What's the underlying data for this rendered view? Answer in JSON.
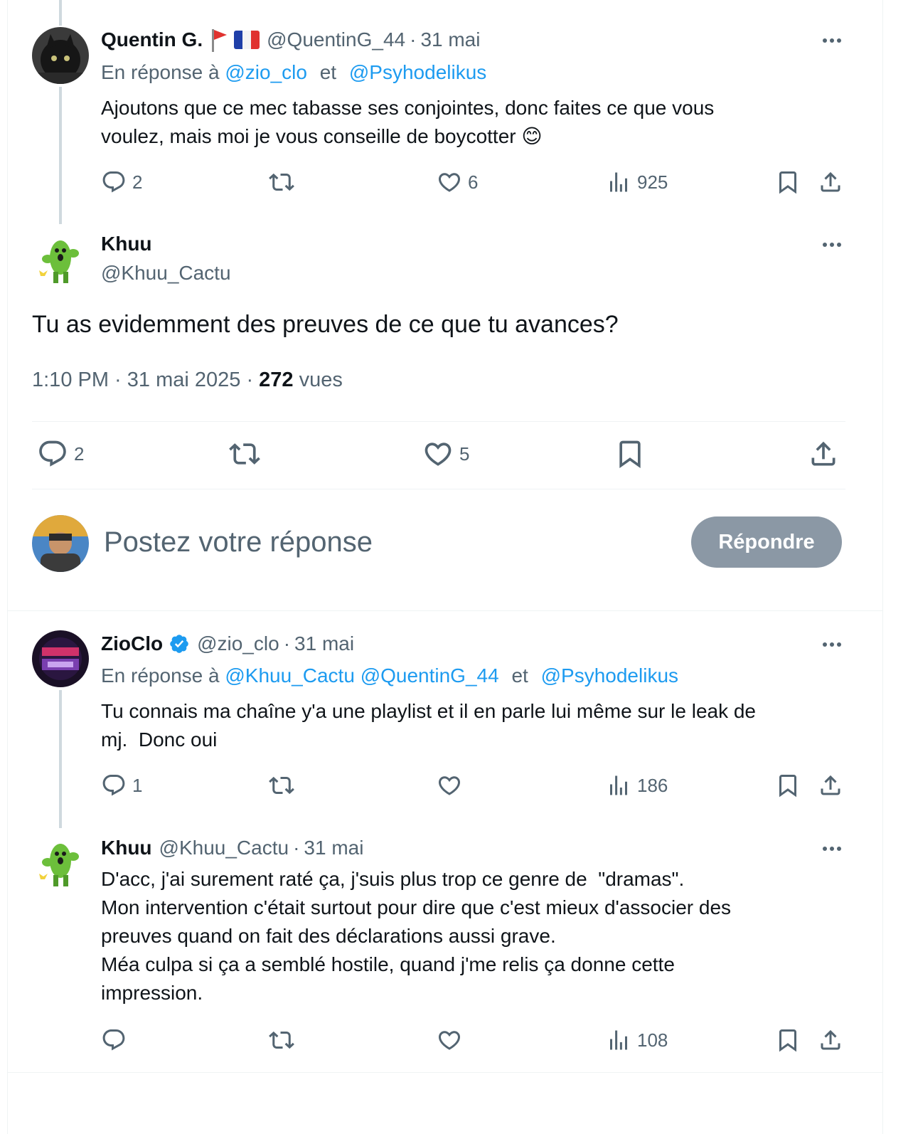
{
  "tweet_quentin": {
    "name": "Quentin G.",
    "handle": "@QuentinG_44",
    "time": "31 mai",
    "reply_prefix": "En réponse à",
    "reply_mention_1": "@zio_clo",
    "reply_and": "et",
    "reply_mention_2": "@Psyhodelikus",
    "line1": "Ajoutons que ce mec tabasse ses conjointes, donc faites ce que vous",
    "line2": "voulez, mais moi je vous conseille de boycotter",
    "emoji": "😊",
    "replies": "2",
    "likes": "6",
    "views": "925"
  },
  "main_tweet": {
    "name": "Khuu",
    "handle": "@Khuu_Cactu",
    "text": "Tu as evidemment des preuves de ce que tu avances?",
    "timestamp": "1:10 PM · 31 mai 2025 · ",
    "views_count": "272",
    "views_label": " vues",
    "replies": "2",
    "likes": "5"
  },
  "compose": {
    "placeholder": "Postez votre réponse",
    "button_label": "Répondre"
  },
  "tweet_zioclo": {
    "name": "ZioClo",
    "handle": "@zio_clo",
    "time": "31 mai",
    "reply_prefix": "En réponse à",
    "reply_mention_1": "@Khuu_Cactu",
    "reply_mention_2": "@QuentinG_44",
    "reply_and": "et",
    "reply_mention_3": "@Psyhodelikus",
    "line1": "Tu connais ma chaîne y'a une playlist et il en parle lui même sur le leak de",
    "line2": "mj.  Donc oui",
    "replies": "1",
    "views": "186"
  },
  "tweet_khuu_reply": {
    "name": "Khuu",
    "handle": "@Khuu_Cactu",
    "time": "31 mai",
    "line1": "D'acc, j'ai surement raté ça, j'suis plus trop ce genre de  \"dramas\".",
    "line2": "Mon intervention c'était surtout pour dire que c'est mieux d'associer des",
    "line3": "preuves quand on fait des déclarations aussi grave.",
    "line4": "Méa culpa si ça a semblé hostile, quand j'me relis ça donne cette",
    "line5": "impression.",
    "views": "108"
  },
  "colors": {
    "link": "#1d9bf0",
    "muted": "#536471",
    "text": "#0f1419",
    "divider": "#eff3f4",
    "reply_button": "#8b98a5"
  },
  "icons": [
    "reply-icon",
    "retweet-icon",
    "like-icon",
    "views-icon",
    "bookmark-icon",
    "share-icon",
    "more-icon",
    "verified-badge-icon",
    "flag-france-icon",
    "red-flag-icon"
  ]
}
